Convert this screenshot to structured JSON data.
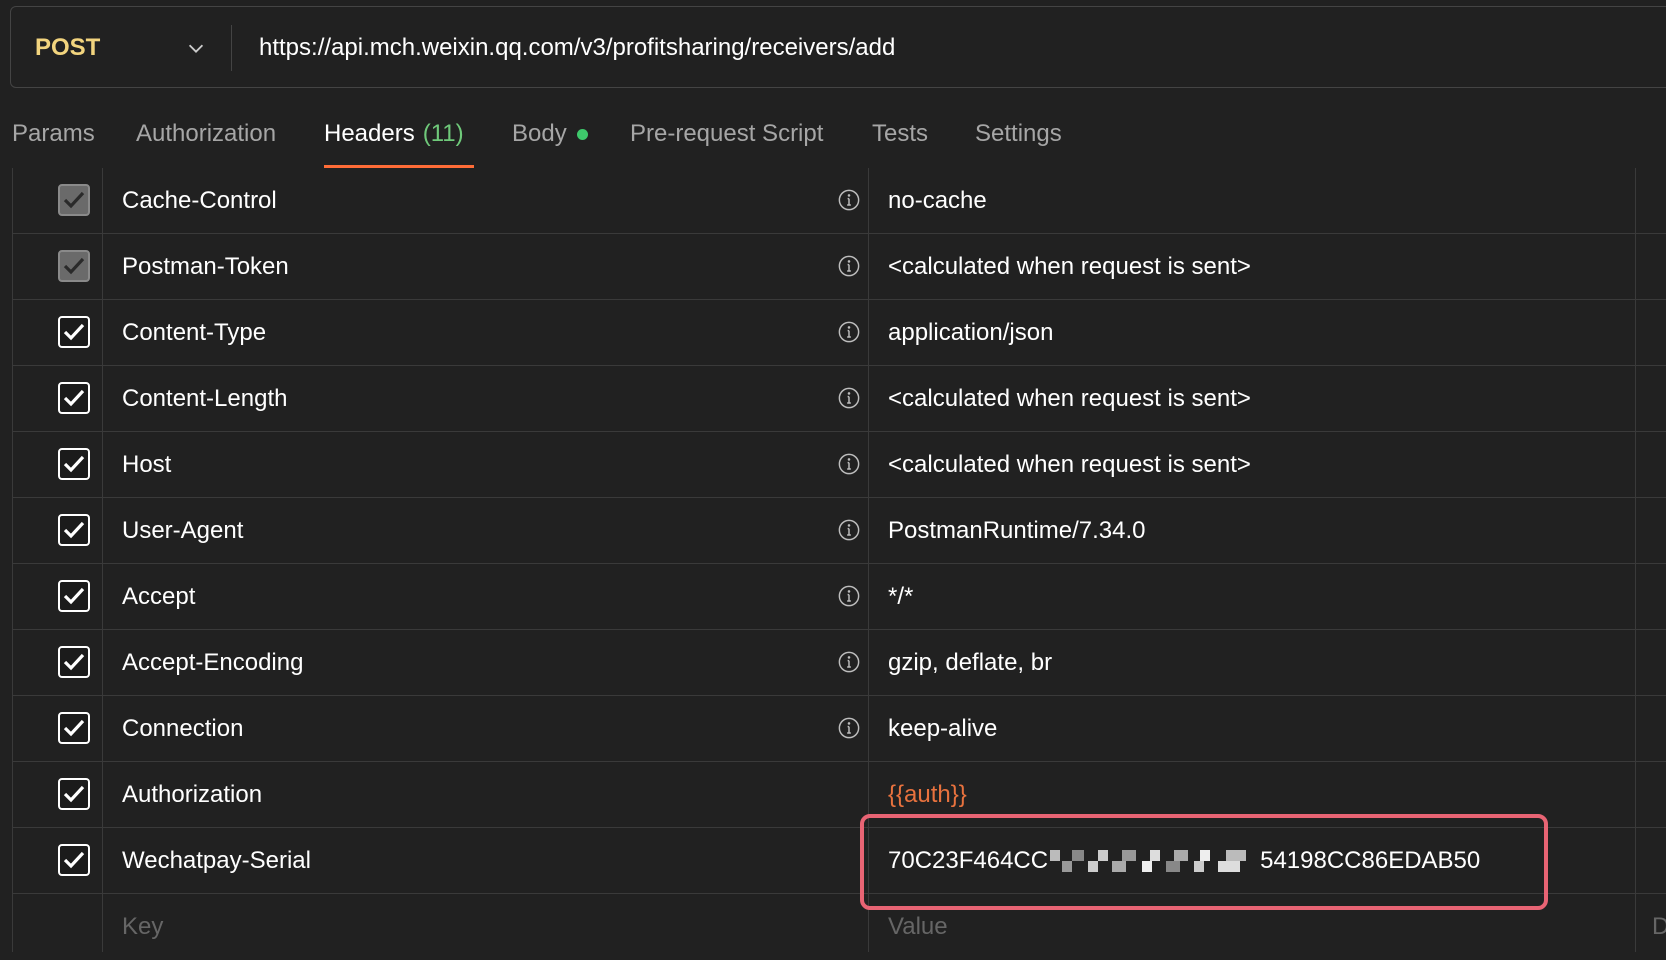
{
  "request": {
    "method": "POST",
    "url": "https://api.mch.weixin.qq.com/v3/profitsharing/receivers/add"
  },
  "tabs": [
    {
      "label": "Params"
    },
    {
      "label": "Authorization"
    },
    {
      "label": "Headers",
      "count": "(11)",
      "active": true
    },
    {
      "label": "Body",
      "has_dot": true
    },
    {
      "label": "Pre-request Script"
    },
    {
      "label": "Tests"
    },
    {
      "label": "Settings"
    }
  ],
  "headers": [
    {
      "key": "Cache-Control",
      "value": "no-cache",
      "checked": true,
      "disabled": true,
      "info": true
    },
    {
      "key": "Postman-Token",
      "value": "<calculated when request is sent>",
      "checked": true,
      "disabled": true,
      "info": true
    },
    {
      "key": "Content-Type",
      "value": "application/json",
      "checked": true,
      "info": true
    },
    {
      "key": "Content-Length",
      "value": "<calculated when request is sent>",
      "checked": true,
      "info": true
    },
    {
      "key": "Host",
      "value": "<calculated when request is sent>",
      "checked": true,
      "info": true
    },
    {
      "key": "User-Agent",
      "value": "PostmanRuntime/7.34.0",
      "checked": true,
      "info": true
    },
    {
      "key": "Accept",
      "value": "*/*",
      "checked": true,
      "info": true
    },
    {
      "key": "Accept-Encoding",
      "value": "gzip, deflate, br",
      "checked": true,
      "info": true
    },
    {
      "key": "Connection",
      "value": "keep-alive",
      "checked": true,
      "info": true
    },
    {
      "key": "Authorization",
      "value": "{{auth}}",
      "checked": true,
      "info": false,
      "is_variable": true
    },
    {
      "key": "Wechatpay-Serial",
      "value_prefix": "70C23F464CC",
      "value_suffix": "54198CC86EDAB50",
      "checked": true,
      "info": false
    }
  ],
  "new_row": {
    "key_placeholder": "Key",
    "value_placeholder": "Value",
    "desc_placeholder": "D"
  },
  "colors": {
    "accent": "#ff6c37",
    "method": "#f2d47e",
    "variable": "#e8723e",
    "highlight": "#e86474",
    "count": "#6fc97a"
  }
}
